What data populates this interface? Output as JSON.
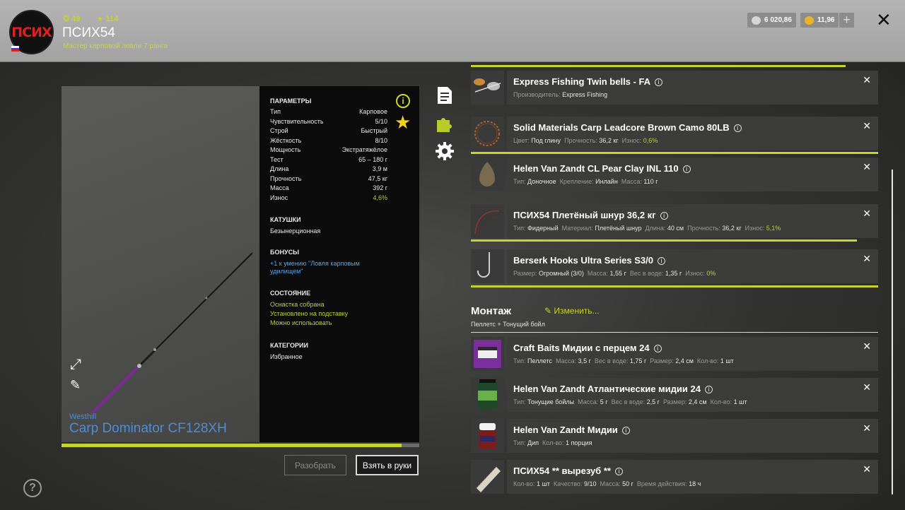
{
  "header": {
    "avatar_text": "ПСИХ",
    "level": "49",
    "stars": "114",
    "username": "ПСИХ54",
    "rank": "Мастер карповой ловли 7 ранга",
    "silver": "6 020,86",
    "gold": "11,96",
    "plus": "+",
    "close": "✕"
  },
  "rod": {
    "brand": "Westhill",
    "name": "Carp Dominator CF128XH",
    "wear_progress": 0.95,
    "params_title": "ПАРАМЕТРЫ",
    "params": [
      {
        "label": "Тип",
        "value": "Карповое"
      },
      {
        "label": "Чувствительность",
        "value": "5/10"
      },
      {
        "label": "Строй",
        "value": "Быстрый"
      },
      {
        "label": "Жёсткость",
        "value": "8/10"
      },
      {
        "label": "Мощность",
        "value": "Экстратяжёлое"
      },
      {
        "label": "Тест",
        "value": "65 – 180 г"
      },
      {
        "label": "Длина",
        "value": "3,9 м"
      },
      {
        "label": "Прочность",
        "value": "47,5 кг"
      },
      {
        "label": "Масса",
        "value": "392 г"
      },
      {
        "label": "Износ",
        "value": "4,6%"
      }
    ],
    "reels_title": "КАТУШКИ",
    "reels_value": "Безынерционная",
    "bonus_title": "БОНУСЫ",
    "bonus_value": "+1 к умению \"Ловля карповым удилищем\"",
    "state_title": "СОСТОЯНИЕ",
    "state_values": [
      "Оснастка собрана",
      "Установлено на подставку",
      "Можно использовать"
    ],
    "cat_title": "КАТЕГОРИИ",
    "cat_value": "Избранное",
    "btn_disassemble": "Разобрать",
    "btn_take": "Взять в руки",
    "info": "i",
    "help": "?"
  },
  "tackle": [
    {
      "title": "Express Fishing Twin bells - FA",
      "props": [
        {
          "k": "Производитель:",
          "v": "Express Fishing"
        }
      ]
    },
    {
      "title": "Solid Materials Carp Leadcore Brown Camo 80LB",
      "props": [
        {
          "k": "Цвет:",
          "v": "Под глину"
        },
        {
          "k": "Прочность:",
          "v": "36,2 кг"
        },
        {
          "k": "Износ:",
          "v": "0,6%",
          "g": true
        }
      ]
    },
    {
      "title": "Helen Van Zandt CL Pear Clay INL 110",
      "props": [
        {
          "k": "Тип:",
          "v": "Доночное"
        },
        {
          "k": "Крепление:",
          "v": "Инлайн"
        },
        {
          "k": "Масса:",
          "v": "110 г"
        }
      ]
    },
    {
      "title": "ПСИХ54 Плетёный шнур 36,2 кг",
      "props": [
        {
          "k": "Тип:",
          "v": "Фидерный"
        },
        {
          "k": "Материал:",
          "v": "Плетёный шнур"
        },
        {
          "k": "Длина:",
          "v": "40 см"
        },
        {
          "k": "Прочность:",
          "v": "36,2 кг"
        },
        {
          "k": "Износ:",
          "v": "5,1%",
          "g": true
        }
      ]
    },
    {
      "title": "Berserk Hooks Ultra Series S3/0",
      "props": [
        {
          "k": "Размер:",
          "v": "Огромный (3/0)"
        },
        {
          "k": "Масса:",
          "v": "1,55 г"
        },
        {
          "k": "Вес в воде:",
          "v": "1,35 г"
        },
        {
          "k": "Износ:",
          "v": "0%",
          "g": true
        }
      ]
    }
  ],
  "montage": {
    "title": "Монтаж",
    "edit": "Изменить...",
    "subtitle": "Пеллетс + Тонущий бойл"
  },
  "baits": [
    {
      "title": "Craft Baits Мидии с перцем 24",
      "props": [
        {
          "k": "Тип:",
          "v": "Пеллетс"
        },
        {
          "k": "Масса:",
          "v": "3,5 г"
        },
        {
          "k": "Вес в воде:",
          "v": "1,75 г"
        },
        {
          "k": "Размер:",
          "v": "2,4 см"
        },
        {
          "k": "Кол-во:",
          "v": "1 шт"
        }
      ]
    },
    {
      "title": "Helen Van Zandt Атлантические мидии 24",
      "props": [
        {
          "k": "Тип:",
          "v": "Тонущие бойлы"
        },
        {
          "k": "Масса:",
          "v": "5 г"
        },
        {
          "k": "Вес в воде:",
          "v": "2,5 г"
        },
        {
          "k": "Размер:",
          "v": "2,4 см"
        },
        {
          "k": "Кол-во:",
          "v": "1 шт"
        }
      ]
    },
    {
      "title": "Helen Van Zandt Мидии",
      "props": [
        {
          "k": "Тип:",
          "v": "Дип"
        },
        {
          "k": "Кол-во:",
          "v": "1 порция"
        }
      ]
    },
    {
      "title": "ПСИХ54 ** вырезуб **",
      "props": [
        {
          "k": "Кол-во:",
          "v": "1 шт"
        },
        {
          "k": "Качество:",
          "v": "9/10"
        },
        {
          "k": "Масса:",
          "v": "50 г"
        },
        {
          "k": "Время действия:",
          "v": "18 ч"
        }
      ]
    }
  ],
  "colors": {
    "accent": "#c4d62c",
    "rod_name": "#4f8cd4",
    "star": "#f2d21a"
  }
}
